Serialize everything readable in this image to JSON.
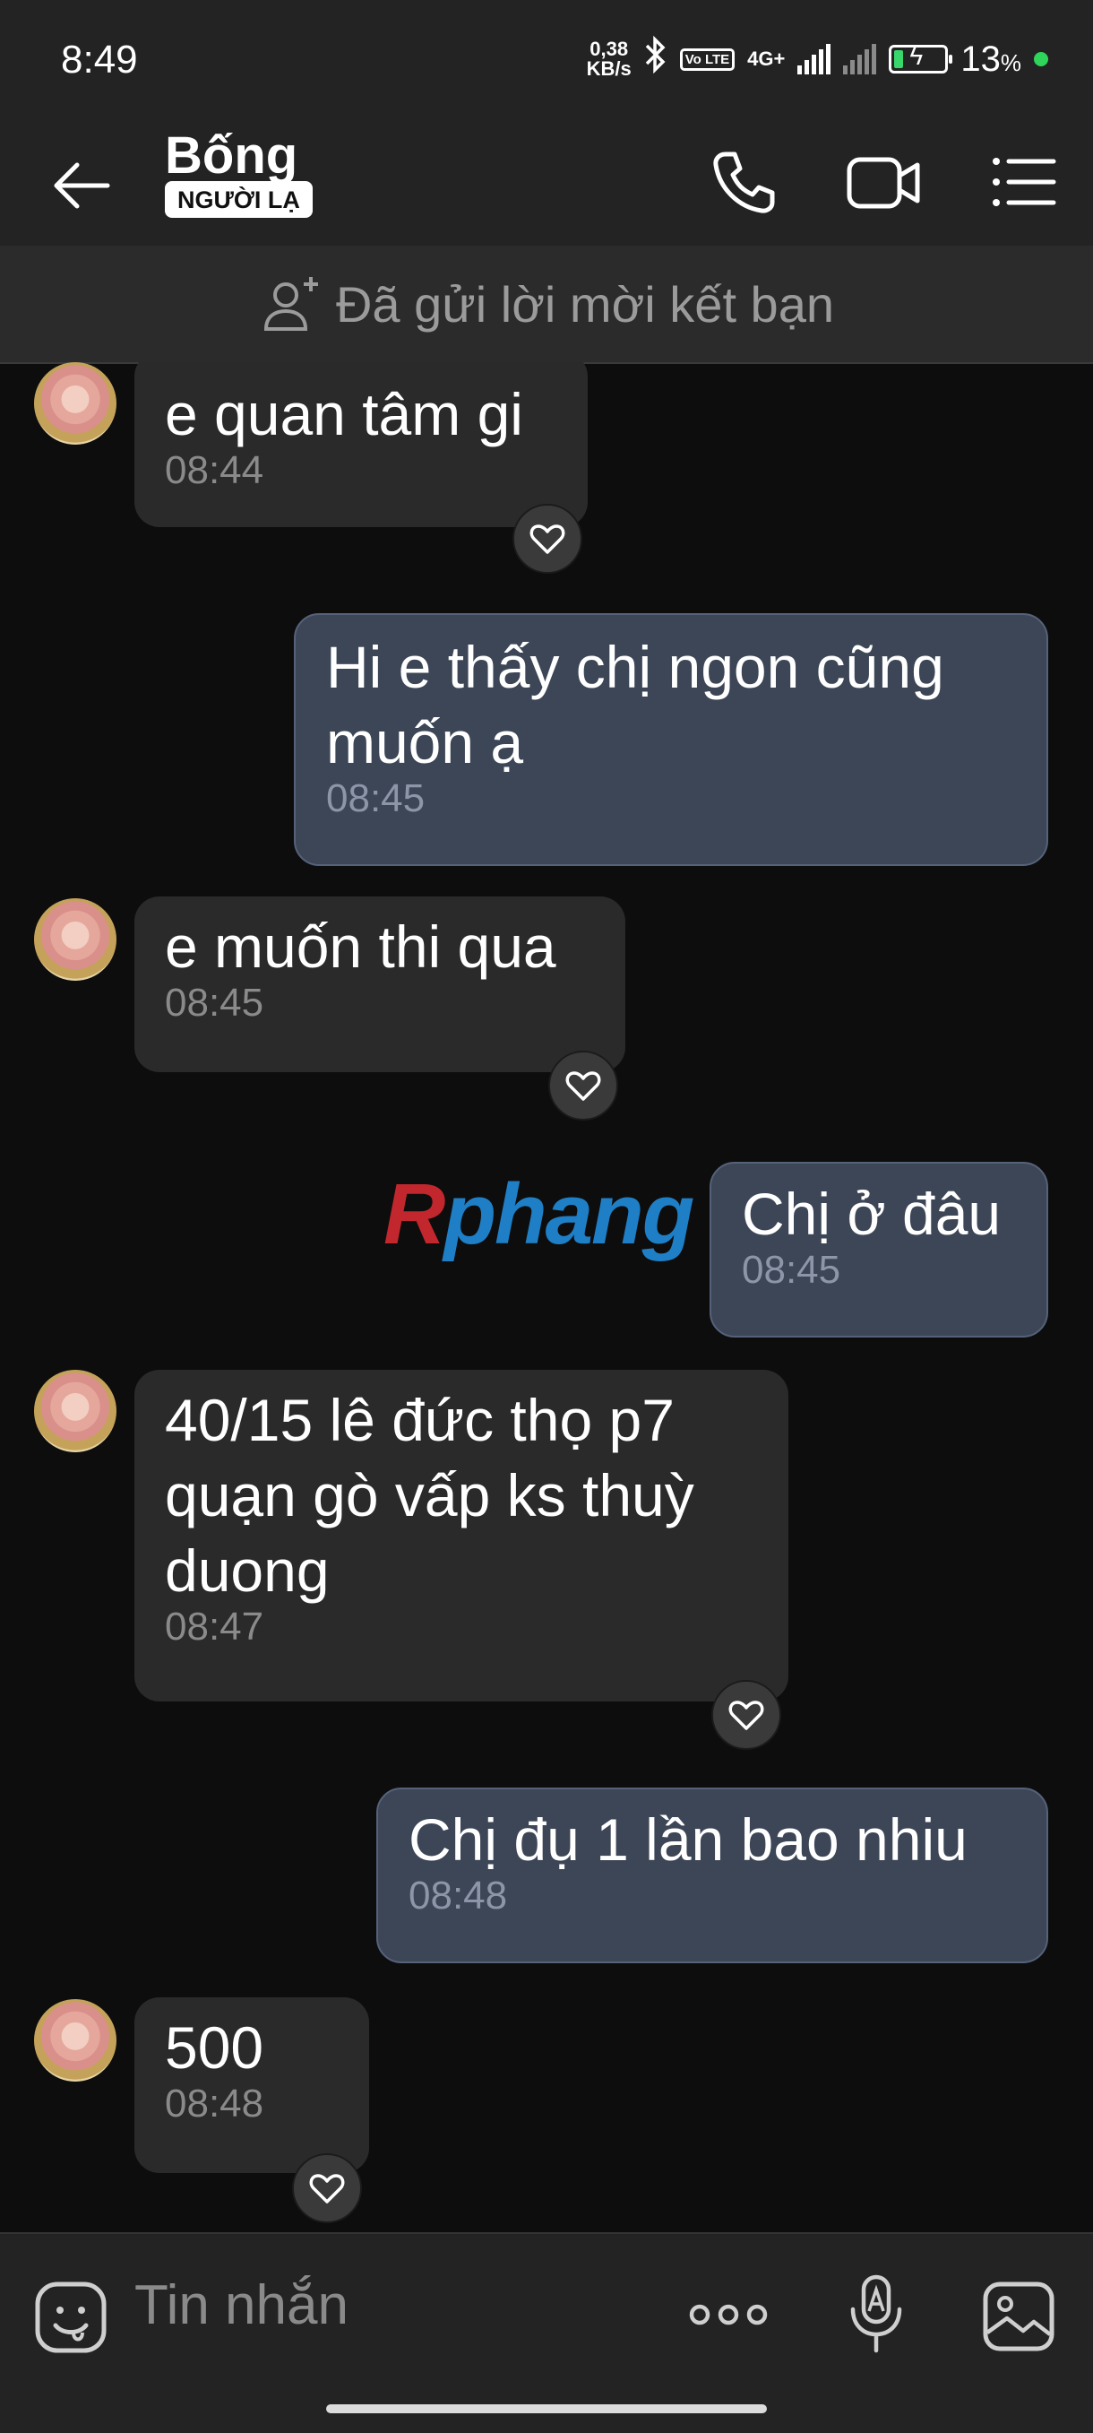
{
  "status_bar": {
    "time": "8:49",
    "net_speed_value": "0,38",
    "net_speed_unit": "KB/s",
    "volte": "Vo LTE",
    "network": "4G+",
    "battery_percent": "13",
    "battery_unit": "%"
  },
  "header": {
    "contact_name": "Bống",
    "stranger_badge": "NGƯỜI LẠ"
  },
  "banner": {
    "text": "Đã gửi lời mời kết bạn"
  },
  "watermark": {
    "first": "R",
    "rest": "phang"
  },
  "messages": [
    {
      "direction": "incoming",
      "lines": [
        "e quan tâm gi"
      ],
      "time": "08:44"
    },
    {
      "direction": "outgoing",
      "lines": [
        "Hi e thấy chị ngon cũng",
        "muốn ạ"
      ],
      "time": "08:45"
    },
    {
      "direction": "incoming",
      "lines": [
        "e muốn thi qua"
      ],
      "time": "08:45"
    },
    {
      "direction": "outgoing",
      "lines": [
        "Chị ở đâu"
      ],
      "time": "08:45"
    },
    {
      "direction": "incoming",
      "lines": [
        "40/15 lê đức thọ p7",
        "quạn gò vấp ks thuỳ",
        "duong"
      ],
      "time": "08:47"
    },
    {
      "direction": "outgoing",
      "lines": [
        "Chị đụ 1 lần bao nhiu"
      ],
      "time": "08:48"
    },
    {
      "direction": "incoming",
      "lines": [
        "500"
      ],
      "time": "08:48"
    }
  ],
  "input_bar": {
    "placeholder": "Tin nhắn"
  },
  "colors": {
    "background": "#0d0d0d",
    "incoming_bubble": "#2a2a2a",
    "outgoing_bubble": "#3c4656",
    "bars": "#232323"
  }
}
